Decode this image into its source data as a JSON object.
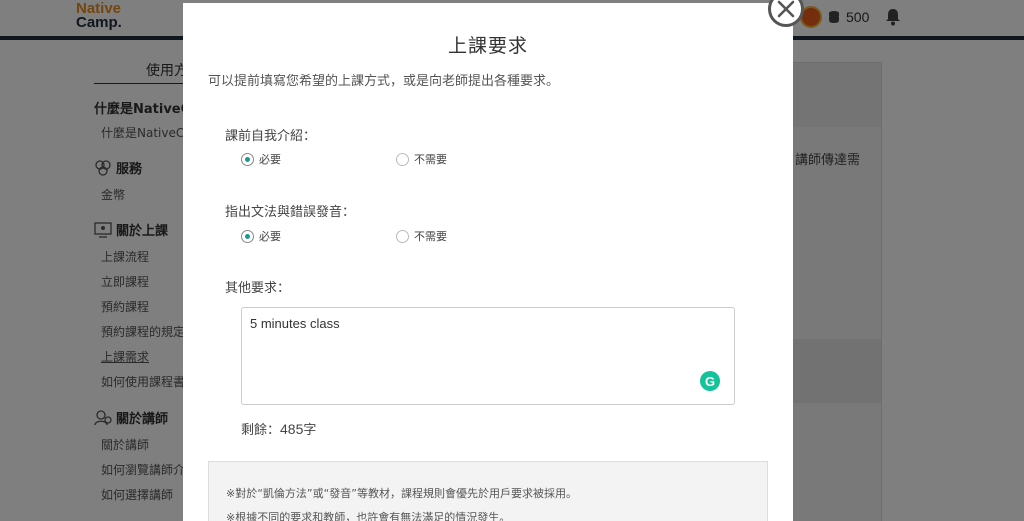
{
  "header": {
    "logo_line1": "Native",
    "logo_line2": "Camp.",
    "coins": "500"
  },
  "sidebar": {
    "title": "使用方",
    "sections": [
      {
        "heading": "什麼是NativeC",
        "items": [
          "什麼是NativeCa"
        ]
      },
      {
        "heading": "服務",
        "items": [
          "金幣"
        ]
      },
      {
        "heading": "關於上課",
        "items": [
          "上課流程",
          "立即課程",
          "預約課程",
          "預約課程的規定",
          "上課需求",
          "如何使用課程書"
        ]
      },
      {
        "heading": "關於講師",
        "items": [
          "關於講師",
          "如何瀏覽講師介",
          "如何選擇講師"
        ]
      }
    ]
  },
  "content": {
    "snippet": "講師傳達需"
  },
  "modal": {
    "title": "上課要求",
    "description": "可以提前填寫您希望的上課方式，或是向老師提出各種要求。",
    "questions": [
      {
        "label": "課前自我介紹：",
        "options": [
          "必要",
          "不需要"
        ],
        "selected": "必要"
      },
      {
        "label": "指出文法與錯誤發音：",
        "options": [
          "必要",
          "不需要"
        ],
        "selected": "必要"
      }
    ],
    "other_label": "其他要求：",
    "other_value": "5 minutes class",
    "remaining_label": "剩餘：",
    "remaining_count": "485",
    "remaining_unit": "字",
    "grammarly_glyph": "G",
    "notes": [
      "※對於“凱倫方法”或“發音”等教材，課程規則會優先於用戶要求被採用。",
      "※根據不同的要求和教師，也許會有無法滿足的情況發生。"
    ]
  },
  "colors": {
    "accent": "#1a9a94",
    "brand_orange": "#e98b1a",
    "brand_navy": "#1f2d3d",
    "grammarly": "#15c39a"
  }
}
